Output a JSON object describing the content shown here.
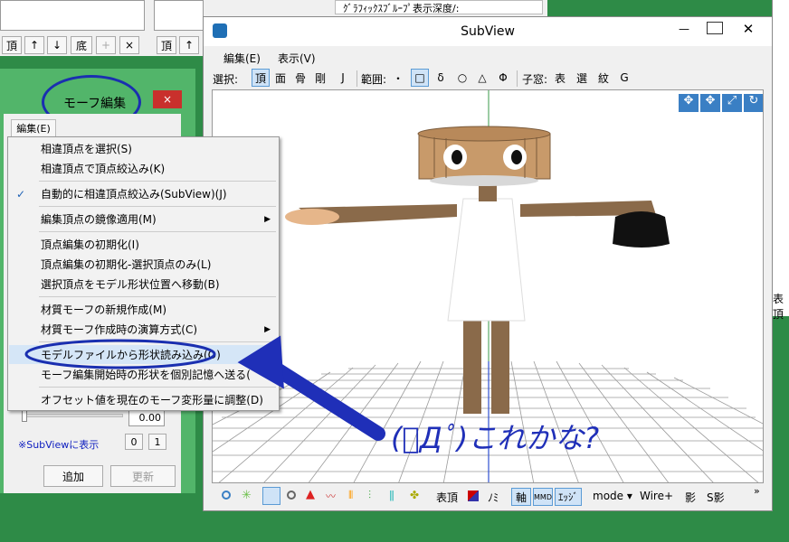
{
  "bg_toolbar": {
    "label_partial": "ｸﾞﾗﾌｨｯｸｽﾌﾞﾙｰﾌﾟ表示深度/:",
    "buttons": [
      "頂",
      "↑",
      "↓",
      "底",
      "+",
      "×"
    ],
    "buttons2": [
      "頂",
      "↑"
    ],
    "right_edge_label": "表頂"
  },
  "morph_window": {
    "title": "モーフ編集",
    "close": "×",
    "menu_tab": "編集(E)",
    "slider_value": "0.00",
    "subview_label": "※SubViewに表示",
    "btn_0": "0",
    "btn_1": "1",
    "add_button": "追加",
    "update_button": "更新"
  },
  "context_menu": {
    "check": "✓",
    "items": [
      "相違頂点を選択(S)",
      "相違頂点で頂点絞込み(K)",
      "自動的に相違頂点絞込み(SubView)(J)",
      "編集頂点の鏡像適用(M)",
      "頂点編集の初期化(I)",
      "頂点編集の初期化-選択頂点のみ(L)",
      "選択頂点をモデル形状位置へ移動(B)",
      "材質モーフの新規作成(M)",
      "材質モーフ作成時の演算方式(C)",
      "モデルファイルから形状読み込み(O)",
      "モーフ編集開始時の形状を個別記憶へ送る(",
      "オフセット値を現在のモーフ変形量に調整(D)"
    ]
  },
  "subview": {
    "title": "SubView",
    "menu": [
      "編集(E)",
      "表示(V)"
    ],
    "toolbar": {
      "select_label": "選択:",
      "select_items": [
        "頂",
        "面",
        "骨",
        "剛",
        "J"
      ],
      "range_label": "範囲:",
      "range_items": [
        "・",
        "□",
        "δ",
        "○",
        "△",
        "Φ"
      ],
      "child_label": "子窓:",
      "child_items": [
        "表",
        "選",
        "紋",
        "G"
      ]
    },
    "bottom_toolbar": [
      "表頂",
      "ﾉﾐ",
      "軸",
      "MMD",
      "ｴｯｼﾞ",
      "mode ▾",
      "Wire+",
      "影",
      "S影"
    ],
    "more": "»"
  },
  "annotation": {
    "text": "(ﾟДﾟ)これかな?",
    "color": "#1f2fb8"
  }
}
